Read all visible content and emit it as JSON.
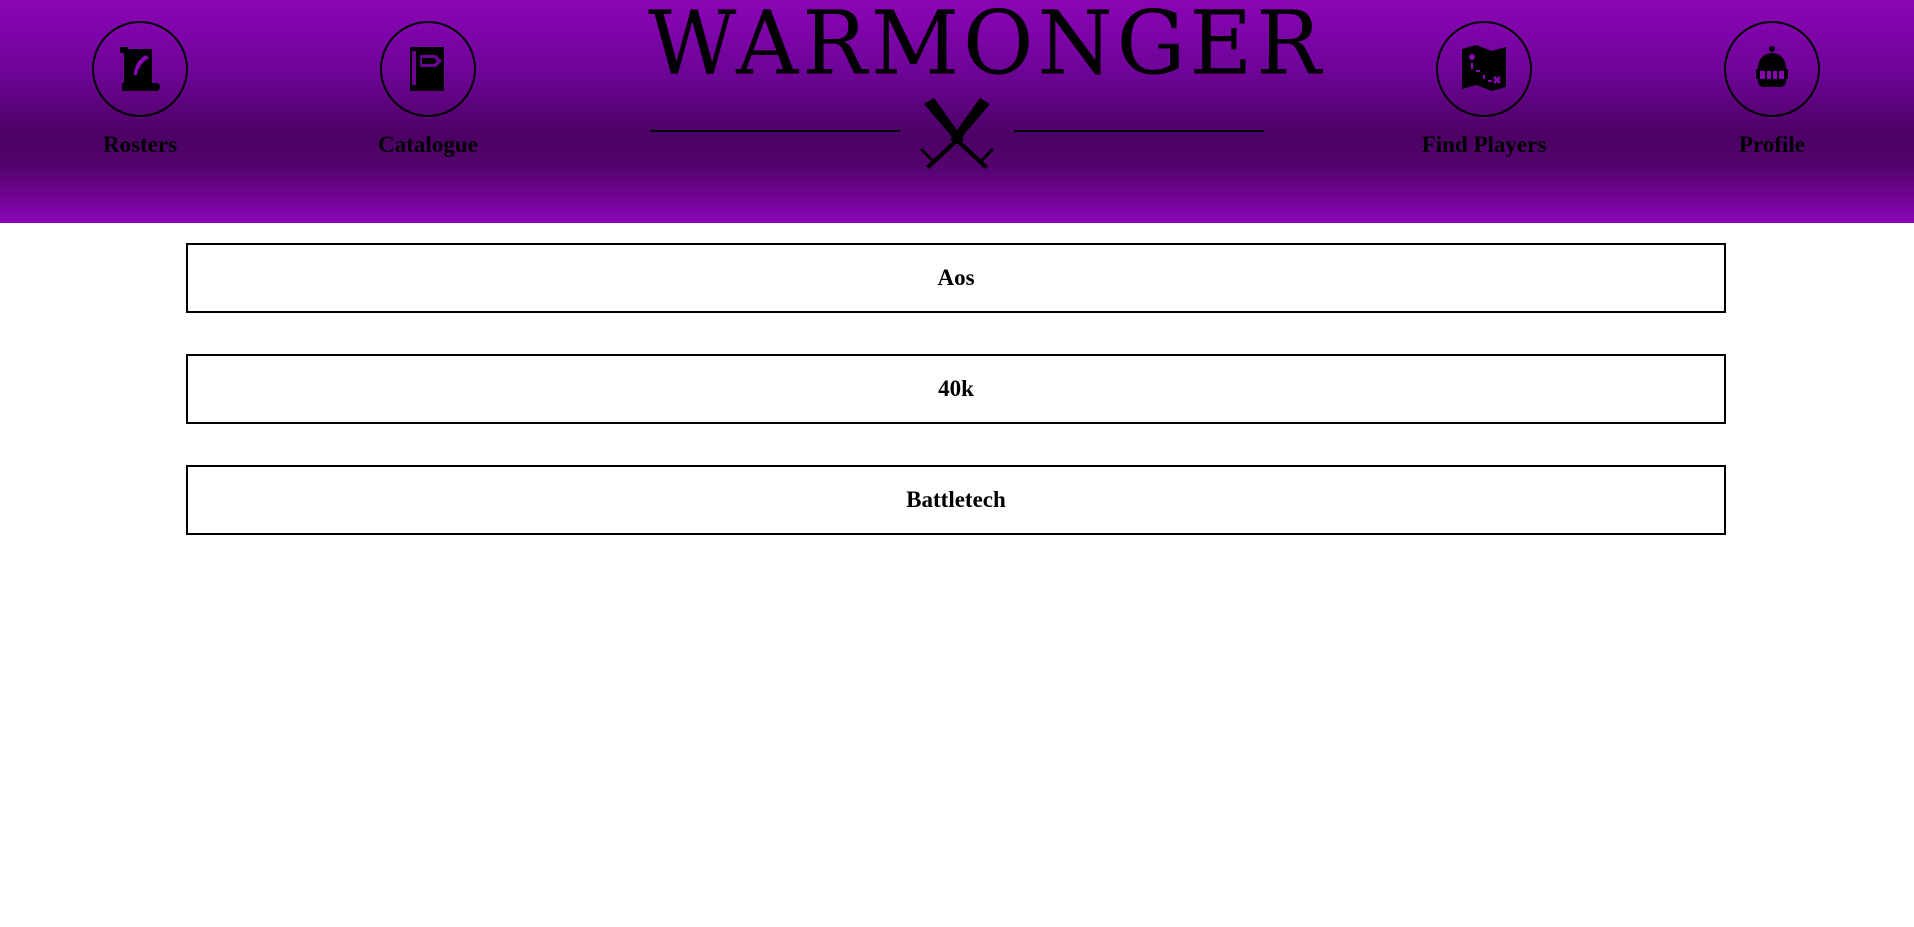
{
  "header": {
    "logo_text": "WARMONGER",
    "nav": {
      "rosters": {
        "label": "Rosters",
        "icon": "scroll-quill-icon"
      },
      "catalogue": {
        "label": "Catalogue",
        "icon": "book-icon"
      },
      "find_players": {
        "label": "Find Players",
        "icon": "treasure-map-icon"
      },
      "profile": {
        "label": "Profile",
        "icon": "knight-helmet-icon"
      }
    },
    "colors": {
      "header_gradient_top": "#8a05b5",
      "header_gradient_dark": "#4b0263"
    }
  },
  "games": [
    {
      "label": "Aos"
    },
    {
      "label": "40k"
    },
    {
      "label": "Battletech"
    }
  ]
}
